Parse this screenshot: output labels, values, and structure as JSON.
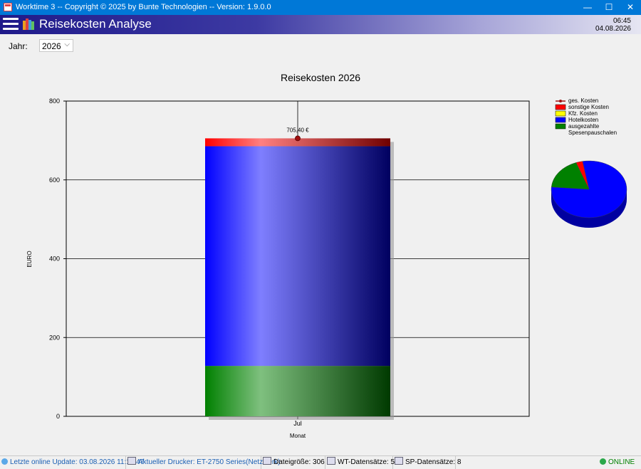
{
  "window": {
    "title": "Worktime 3 -- Copyright © 2025 by Bunte Technologien -- Version: 1.9.0.0",
    "minimize_glyph": "—",
    "maximize_glyph": "☐",
    "close_glyph": "✕"
  },
  "header": {
    "title": "Reisekosten Analyse",
    "time": "06:45",
    "date": "04.08.2026"
  },
  "filter": {
    "year_label": "Jahr:",
    "year_value": "2026"
  },
  "chart_data": {
    "type": "bar",
    "title": "Reisekosten 2026",
    "xlabel": "Monat",
    "ylabel": "EURO",
    "ylim": [
      0,
      800
    ],
    "yticks": [
      "0",
      "200",
      "400",
      "600",
      "800"
    ],
    "categories": [
      "Jul"
    ],
    "series": [
      {
        "name": "ausgezahlte Spesenpauschalen",
        "values": [
          128
        ],
        "color": "#008000"
      },
      {
        "name": "Hotelkosten",
        "values": [
          557.4
        ],
        "color": "#0000ff"
      },
      {
        "name": "Kfz. Kosten",
        "values": [
          0
        ],
        "color": "#ffff00"
      },
      {
        "name": "sonstige Kosten",
        "values": [
          20
        ],
        "color": "#ff0000"
      }
    ],
    "total_series": {
      "name": "ges. Kosten",
      "values": [
        705.4
      ],
      "label": "705,40 €",
      "color": "#a01010"
    },
    "legend": [
      "ges. Kosten",
      "sonstige Kosten",
      "Kfz. Kosten",
      "Hotelkosten",
      "ausgezahlte",
      "Spesenpauschalen"
    ],
    "legend_position": "top-right",
    "grid": true,
    "pie": {
      "values": [
        20,
        0,
        557.4,
        128
      ],
      "colors": [
        "#ff0000",
        "#ffff00",
        "#0000ff",
        "#008000"
      ]
    }
  },
  "status": {
    "last_update": "Letzte online Update: 03.08.2026 11:18:47",
    "printer": "Aktueller Drucker: ET-2750 Series(Netzwerk)",
    "filesize": "Dateigröße: 306 KB",
    "wt_records": "WT-Datensätze: 581",
    "sp_records": "SP-Datensätze: 8",
    "online": "ONLINE"
  },
  "colors": {
    "titlebar": "#0078d7",
    "header_start": "#1f1a8a",
    "status_link": "#1a5fb4",
    "online": "#008000"
  }
}
